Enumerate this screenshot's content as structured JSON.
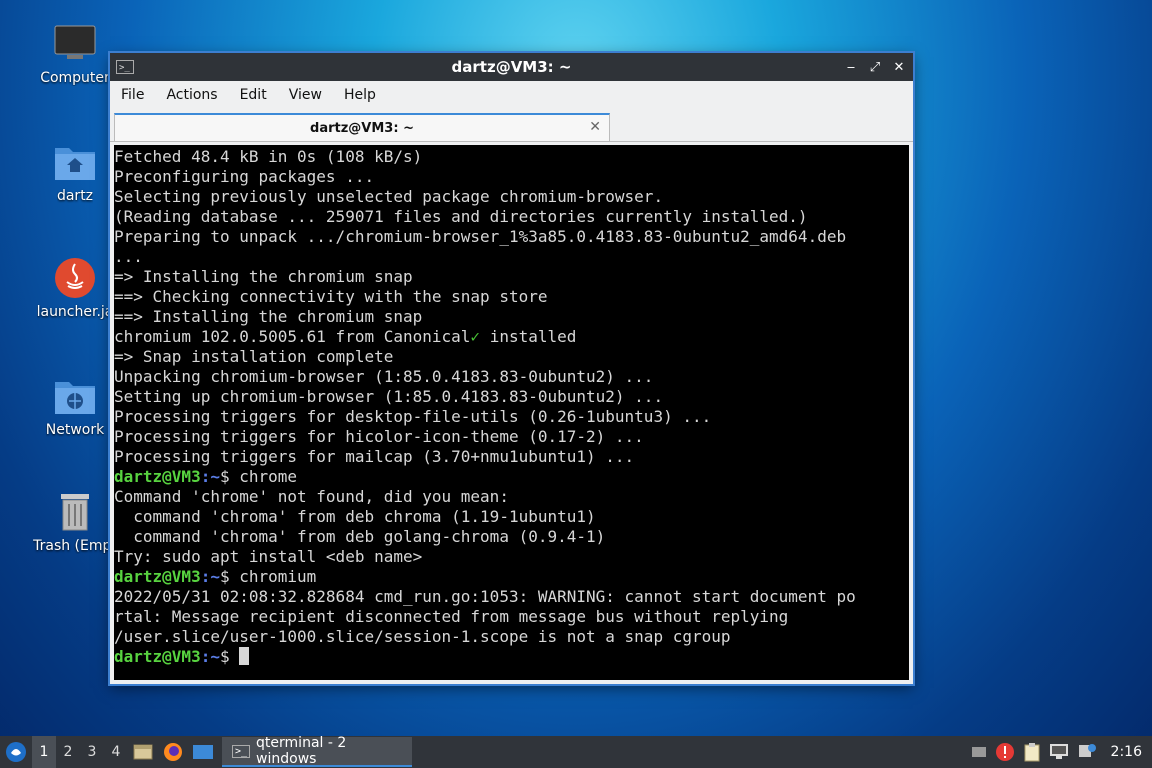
{
  "desktop": {
    "icons": [
      {
        "label": "Computer",
        "icon": "monitor-icon"
      },
      {
        "label": "dartz",
        "icon": "home-folder-icon"
      },
      {
        "label": "launcher.ja",
        "icon": "java-icon"
      },
      {
        "label": "Network",
        "icon": "network-folder-icon"
      },
      {
        "label": "Trash (Empt",
        "icon": "trash-icon"
      }
    ]
  },
  "window": {
    "title": "dartz@VM3: ~",
    "menu": [
      "File",
      "Actions",
      "Edit",
      "View",
      "Help"
    ],
    "tab_label": "dartz@VM3: ~",
    "tab_close": "✕"
  },
  "terminal": {
    "prompt_user": "dartz@VM3",
    "prompt_path": ":~",
    "prompt_sign": "$ ",
    "lines": {
      "l1": "Fetched 48.4 kB in 0s (108 kB/s)",
      "l2": "Preconfiguring packages ...",
      "l3": "Selecting previously unselected package chromium-browser.",
      "l4": "(Reading database ... 259071 files and directories currently installed.)",
      "l5": "Preparing to unpack .../chromium-browser_1%3a85.0.4183.83-0ubuntu2_amd64.deb",
      "l6": "...",
      "l7": "=> Installing the chromium snap",
      "l8": "==> Checking connectivity with the snap store",
      "l9": "==> Installing the chromium snap",
      "l10a": "chromium 102.0.5005.61 from Canonical",
      "l10check": "✓",
      "l10b": " installed",
      "l11": "=> Snap installation complete",
      "l12": "Unpacking chromium-browser (1:85.0.4183.83-0ubuntu2) ...",
      "l13": "Setting up chromium-browser (1:85.0.4183.83-0ubuntu2) ...",
      "l14": "Processing triggers for desktop-file-utils (0.26-1ubuntu3) ...",
      "l15": "Processing triggers for hicolor-icon-theme (0.17-2) ...",
      "l16": "Processing triggers for mailcap (3.70+nmu1ubuntu1) ...",
      "cmd1": "chrome",
      "l18": "Command 'chrome' not found, did you mean:",
      "l19": "  command 'chroma' from deb chroma (1.19-1ubuntu1)",
      "l20": "  command 'chroma' from deb golang-chroma (0.9.4-1)",
      "l21": "Try: sudo apt install <deb name>",
      "cmd2": "chromium",
      "l23": "2022/05/31 02:08:32.828684 cmd_run.go:1053: WARNING: cannot start document po",
      "l24": "rtal: Message recipient disconnected from message bus without replying",
      "l25": "/user.slice/user-1000.slice/session-1.scope is not a snap cgroup"
    }
  },
  "taskbar": {
    "workspaces": [
      "1",
      "2",
      "3",
      "4"
    ],
    "task_label": "qterminal - 2 windows",
    "clock": "2:16"
  },
  "colors": {
    "accent": "#3c8ad8",
    "prompt_green": "#58d340",
    "prompt_blue": "#5b7ee8"
  }
}
